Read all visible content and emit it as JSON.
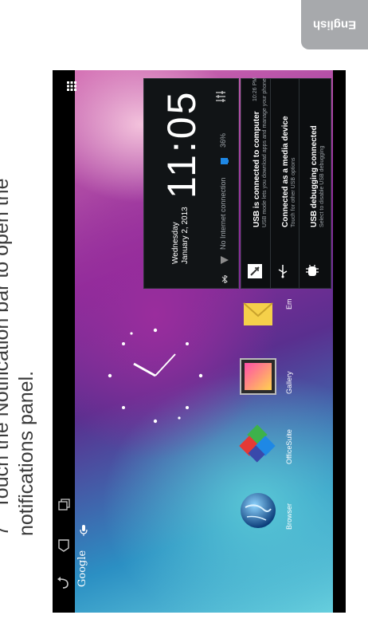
{
  "manual": {
    "language_tab": "English",
    "instruction": "Touch the Notification bar to open the notifications panel.",
    "step_number": "7"
  },
  "home": {
    "search_label": "Google",
    "apps": [
      {
        "label": "Browser"
      },
      {
        "label": "OfficeSuite"
      },
      {
        "label": "Gallery"
      },
      {
        "label": "Em"
      }
    ]
  },
  "notifications": {
    "day": "Wednesday",
    "date": "January 2, 2013",
    "time": "11:05",
    "network_status": "No Internet connection",
    "battery": "36%",
    "items": [
      {
        "title": "USB is connected to computer",
        "subtitle": "USB mode lets you download apps and manage your phone",
        "time": "10:26 PM"
      },
      {
        "title": "Connected as a media device",
        "subtitle": "Touch for other USB options",
        "time": ""
      },
      {
        "title": "USB debugging connected",
        "subtitle": "Select to disable USB debugging",
        "time": ""
      }
    ]
  },
  "colors": {
    "panel_bg": "#111416",
    "accent": "#33b5e5",
    "tab_grey": "#a7a9ac"
  }
}
